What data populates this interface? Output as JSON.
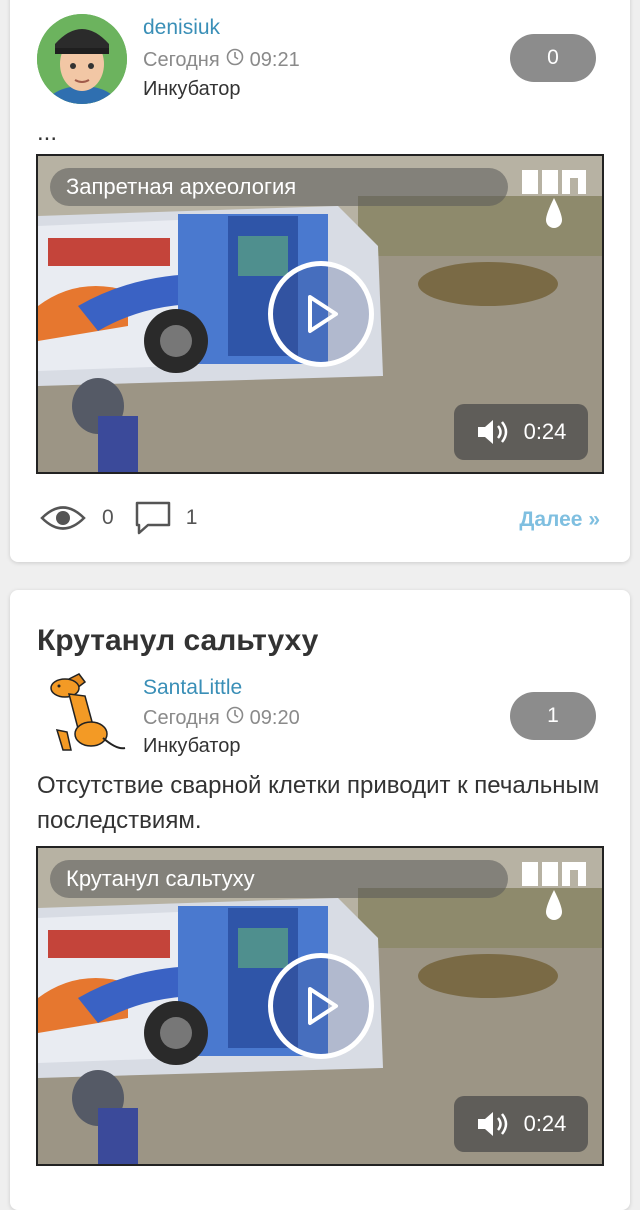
{
  "posts": [
    {
      "author": "denisiuk",
      "date": "Сегодня",
      "time": "09:21",
      "category": "Инкубатор",
      "rating": "0",
      "text": "...",
      "video_title": "Запретная археология",
      "duration": "0:24",
      "views": "0",
      "comments": "1",
      "more": "Далее »"
    },
    {
      "title": "Крутанул сальтуху",
      "author": "SantaLittle",
      "date": "Сегодня",
      "time": "09:20",
      "category": "Инкубатор",
      "rating": "1",
      "text": "Отсутствие сварной клетки приводит к печальным последствиям.",
      "video_title": "Крутанул сальтуху",
      "duration": "0:24"
    }
  ],
  "icons": {
    "clock": "clock-icon",
    "views": "eye-icon",
    "comments": "comment-bubble-icon",
    "play": "play-icon",
    "volume": "speaker-icon",
    "logo": "yap-logo-icon"
  },
  "colors": {
    "author": "#3a8fb7",
    "more_link": "#7fbfe0",
    "rating_bg": "#8c8c8c"
  }
}
